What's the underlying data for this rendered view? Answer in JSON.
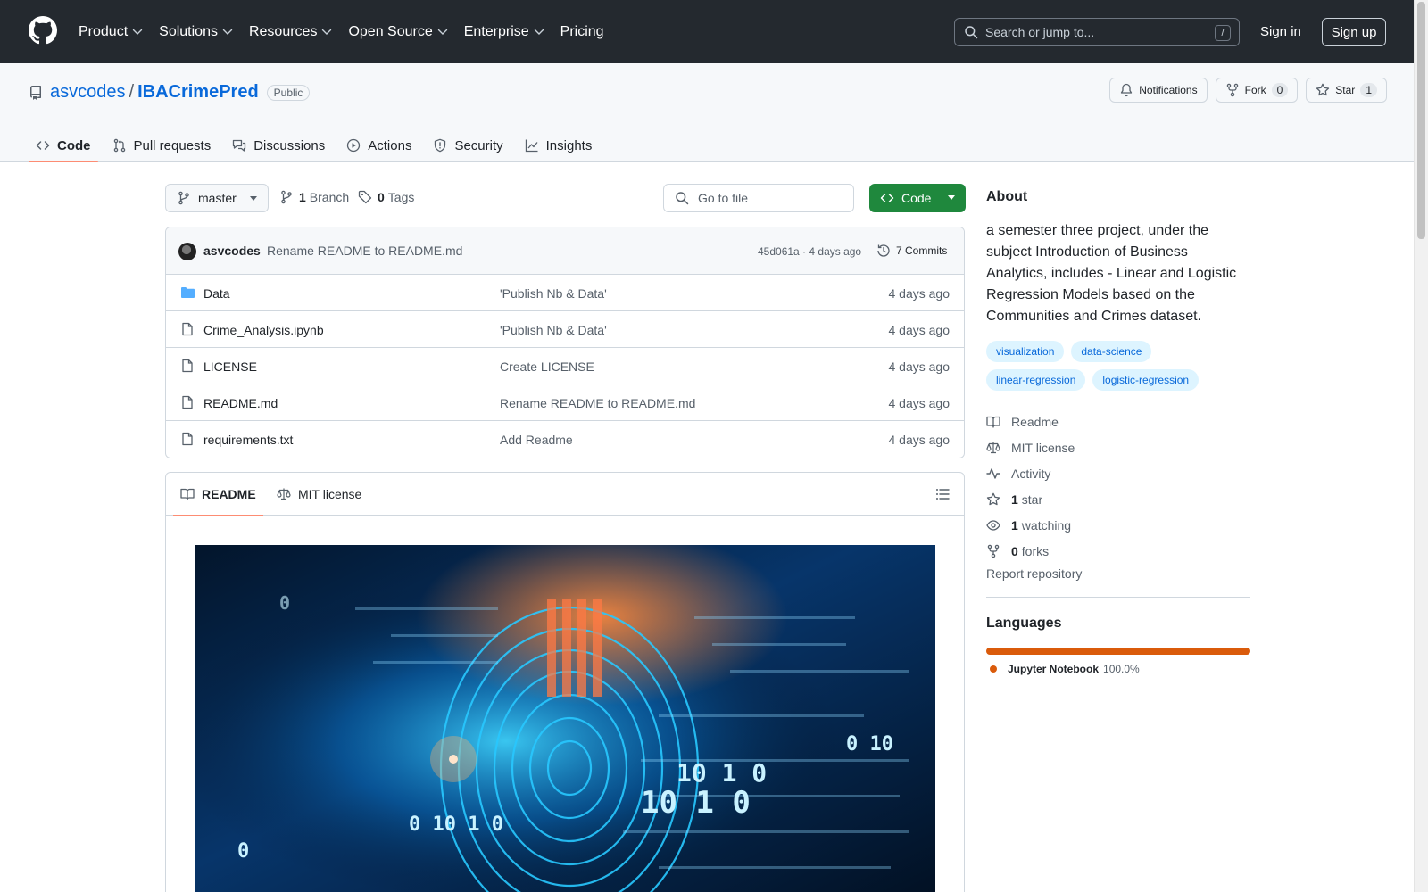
{
  "header": {
    "nav": [
      {
        "label": "Product",
        "chevron": true
      },
      {
        "label": "Solutions",
        "chevron": true
      },
      {
        "label": "Resources",
        "chevron": true
      },
      {
        "label": "Open Source",
        "chevron": true
      },
      {
        "label": "Enterprise",
        "chevron": true
      },
      {
        "label": "Pricing",
        "chevron": false
      }
    ],
    "search_placeholder": "Search or jump to...",
    "search_shortcut": "/",
    "sign_in": "Sign in",
    "sign_up": "Sign up"
  },
  "repo": {
    "owner": "asvcodes",
    "separator": "/",
    "name": "IBACrimePred",
    "visibility": "Public",
    "notifications_label": "Notifications",
    "fork_label": "Fork",
    "fork_count": "0",
    "star_label": "Star",
    "star_count": "1"
  },
  "tabs": [
    {
      "label": "Code",
      "icon": "code-icon",
      "active": true
    },
    {
      "label": "Pull requests",
      "icon": "pull-request-icon"
    },
    {
      "label": "Discussions",
      "icon": "discussions-icon"
    },
    {
      "label": "Actions",
      "icon": "play-icon"
    },
    {
      "label": "Security",
      "icon": "shield-icon"
    },
    {
      "label": "Insights",
      "icon": "graph-icon"
    }
  ],
  "toolbar": {
    "branch": "master",
    "branch_count": "1",
    "branch_label": "Branch",
    "tag_count": "0",
    "tag_label": "Tags",
    "goto_placeholder": "Go to file",
    "code_button": "Code"
  },
  "commit": {
    "author": "asvcodes",
    "message": "Rename README to README.md",
    "hash_time": "45d061a · 4 days ago",
    "count_label": "7 Commits"
  },
  "files": [
    {
      "name": "Data",
      "type": "folder",
      "message": "'Publish Nb & Data'",
      "date": "4 days ago"
    },
    {
      "name": "Crime_Analysis.ipynb",
      "type": "file",
      "message": "'Publish Nb & Data'",
      "date": "4 days ago"
    },
    {
      "name": "LICENSE",
      "type": "file",
      "message": "Create LICENSE",
      "date": "4 days ago"
    },
    {
      "name": "README.md",
      "type": "file",
      "message": "Rename README to README.md",
      "date": "4 days ago"
    },
    {
      "name": "requirements.txt",
      "type": "file",
      "message": "Add Readme",
      "date": "4 days ago"
    }
  ],
  "readme": {
    "tab_readme": "README",
    "tab_license": "MIT license"
  },
  "about": {
    "heading": "About",
    "description": "a semester three project, under the subject Introduction of Business Analytics, includes - Linear and Logistic Regression Models based on the Communities and Crimes dataset.",
    "topics": [
      "visualization",
      "data-science",
      "linear-regression",
      "logistic-regression"
    ],
    "links": [
      {
        "icon": "book-icon",
        "bold": "",
        "text": "Readme"
      },
      {
        "icon": "law-icon",
        "bold": "",
        "text": "MIT license"
      },
      {
        "icon": "pulse-icon",
        "bold": "",
        "text": "Activity"
      },
      {
        "icon": "star-icon",
        "bold": "1",
        "text": "star"
      },
      {
        "icon": "eye-icon",
        "bold": "1",
        "text": "watching"
      },
      {
        "icon": "fork-icon",
        "bold": "0",
        "text": "forks"
      }
    ],
    "report": "Report repository"
  },
  "languages": {
    "heading": "Languages",
    "items": [
      {
        "name": "Jupyter Notebook",
        "percent_label": "100.0%",
        "percent": 100.0,
        "color": "#DA5B0B"
      }
    ]
  },
  "hero_overlay": {
    "digits": [
      "0",
      "10 1 0",
      "0 10 1 0",
      "10 1 0",
      "0 10",
      "0"
    ]
  }
}
